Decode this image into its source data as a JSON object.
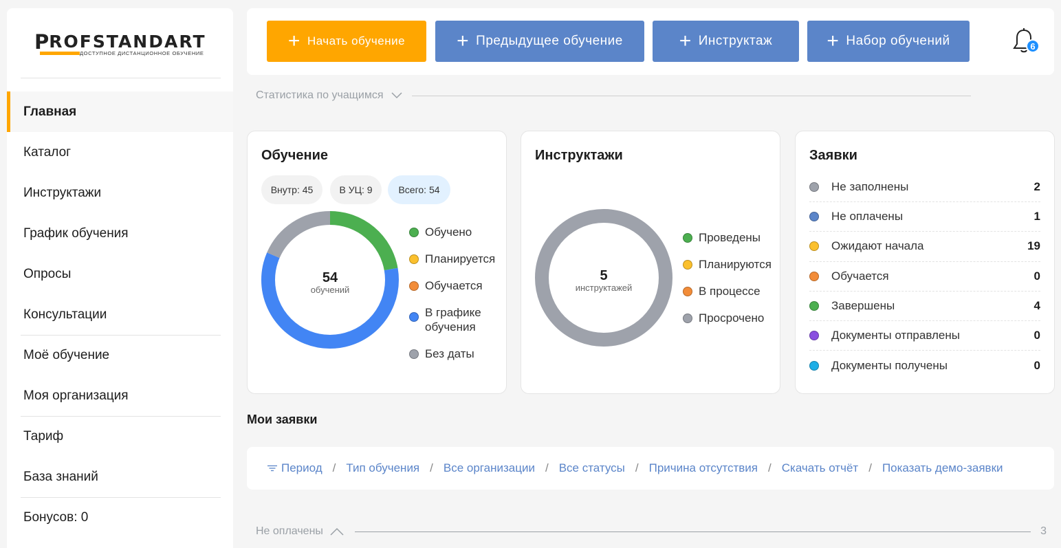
{
  "logo": {
    "brand": "PROFSTANDART",
    "tagline": "ДОСТУПНОЕ ДИСТАНЦИОННОЕ ОБУЧЕНИЕ"
  },
  "nav": {
    "items": [
      {
        "label": "Главная"
      },
      {
        "label": "Каталог"
      },
      {
        "label": "Инструктажи"
      },
      {
        "label": "График обучения"
      },
      {
        "label": "Опросы"
      },
      {
        "label": "Консультации"
      },
      {
        "label": "Моё обучение"
      },
      {
        "label": "Моя организация"
      },
      {
        "label": "Тариф"
      },
      {
        "label": "База знаний"
      },
      {
        "label": "Бонусов: 0"
      }
    ]
  },
  "toolbar": {
    "buttons": [
      {
        "label": "Начать обучение"
      },
      {
        "label": "Предыдущее обучение"
      },
      {
        "label": "Инструктаж"
      },
      {
        "label": "Набор обучений"
      }
    ],
    "notifications": "6"
  },
  "stats_section": {
    "label": "Статистика по учащимся"
  },
  "training_card": {
    "title": "Обучение",
    "pills": [
      "Внутр: 45",
      "В УЦ: 9",
      "Всего: 54"
    ],
    "total": "54",
    "total_label": "обучений",
    "legend": [
      {
        "label": "Обучено",
        "color": "#4caf50"
      },
      {
        "label": "Планируется",
        "color": "#fbc02d"
      },
      {
        "label": "Обучается",
        "color": "#f28c38"
      },
      {
        "label": "В графике обучения",
        "color": "#4285f4"
      },
      {
        "label": "Без даты",
        "color": "#9ea2ab"
      }
    ]
  },
  "briefing_card": {
    "title": "Инструктажи",
    "total": "5",
    "total_label": "инструктажей",
    "legend": [
      {
        "label": "Проведены",
        "color": "#4caf50"
      },
      {
        "label": "Планируются",
        "color": "#fbc02d"
      },
      {
        "label": "В процессе",
        "color": "#f28c38"
      },
      {
        "label": "Просрочено",
        "color": "#9ea2ab"
      }
    ]
  },
  "requests_card": {
    "title": "Заявки",
    "rows": [
      {
        "label": "Не заполнены",
        "count": "2",
        "color": "#9ea2ab"
      },
      {
        "label": "Не оплачены",
        "count": "1",
        "color": "#5b85c9"
      },
      {
        "label": "Ожидают начала",
        "count": "19",
        "color": "#fbc02d"
      },
      {
        "label": "Обучается",
        "count": "0",
        "color": "#f28c38"
      },
      {
        "label": "Завершены",
        "count": "4",
        "color": "#4caf50"
      },
      {
        "label": "Документы отправлены",
        "count": "0",
        "color": "#8a4fe0"
      },
      {
        "label": "Документы получены",
        "count": "0",
        "color": "#1eaee6"
      }
    ]
  },
  "my_requests": {
    "title": "Мои заявки",
    "filters": [
      "Период",
      "Тип обучения",
      "Все организации",
      "Все статусы",
      "Причина отсутствия",
      "Скачать отчёт",
      "Показать демо-заявки"
    ],
    "separator": "/"
  },
  "unpaid_section": {
    "label": "Не оплачены",
    "count": "3"
  },
  "chart_data": [
    {
      "type": "pie",
      "title": "Обучение",
      "categories": [
        "Обучено",
        "Планируется",
        "Обучается",
        "В графике обучения",
        "Без даты"
      ],
      "values": [
        12,
        0,
        0,
        32,
        10
      ],
      "total": 54
    },
    {
      "type": "pie",
      "title": "Инструктажи",
      "categories": [
        "Проведены",
        "Планируются",
        "В процессе",
        "Просрочено"
      ],
      "values": [
        0,
        0,
        0,
        5
      ],
      "total": 5
    }
  ]
}
